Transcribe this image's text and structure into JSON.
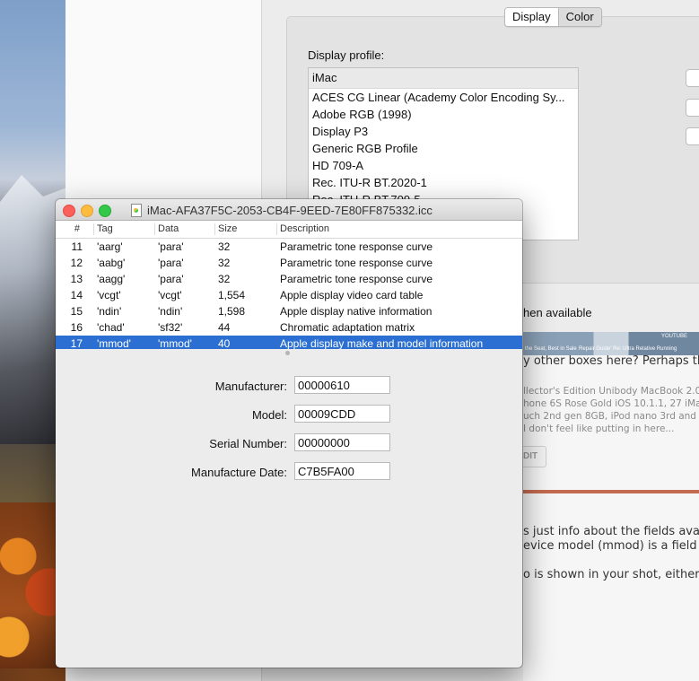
{
  "background_window": {
    "segmented": {
      "display_label": "Display",
      "color_label": "Color"
    },
    "display_profile_label": "Display profile:",
    "profile_list_header": "iMac",
    "profiles": [
      "ACES CG Linear (Academy Color Encoding Sy...",
      "Adobe RGB (1998)",
      "Display P3",
      "Generic RGB Profile",
      "HD 709-A",
      "Rec. ITU-R BT.2020-1",
      "Rec. ITU-R BT.709-5"
    ],
    "when_available_text": "hen available"
  },
  "webpage_fragment": {
    "thumb_caption_left": "the Seat, Best in Sale",
    "thumb_caption_mid": "Repair Guide' Re: Ultra Relative Running",
    "thumb_caption_right": "YOUTUBE",
    "line1": "y other boxes here? Perhaps the",
    "small_lines": [
      "llector's Edition Unibody MacBook 2.0 C",
      "hone 6S Rose Gold iOS 10.1.1, 27 iMac",
      "uch 2nd gen 8GB, iPod nano 3rd and 4",
      "I don't feel like putting in here..."
    ],
    "edit_label": "DIT",
    "para1": "s just info about the fields availa",
    "para2": "evice model (mmod) is a field of i",
    "para3": "o is shown in your shot, either."
  },
  "icc_window": {
    "title": "iMac-AFA37F5C-2053-CB4F-9EED-7E80FF875332.icc",
    "columns": [
      "#",
      "Tag",
      "Data",
      "Size",
      "Description"
    ],
    "rows": [
      {
        "num": "11",
        "tag": "'aarg'",
        "data": "'para'",
        "size": "32",
        "desc": "Parametric tone response curve"
      },
      {
        "num": "12",
        "tag": "'aabg'",
        "data": "'para'",
        "size": "32",
        "desc": "Parametric tone response curve"
      },
      {
        "num": "13",
        "tag": "'aagg'",
        "data": "'para'",
        "size": "32",
        "desc": "Parametric tone response curve"
      },
      {
        "num": "14",
        "tag": "'vcgt'",
        "data": "'vcgt'",
        "size": "1,554",
        "desc": "Apple display video card table"
      },
      {
        "num": "15",
        "tag": "'ndin'",
        "data": "'ndin'",
        "size": "1,598",
        "desc": "Apple display native information"
      },
      {
        "num": "16",
        "tag": "'chad'",
        "data": "'sf32'",
        "size": "44",
        "desc": "Chromatic adaptation matrix"
      },
      {
        "num": "17",
        "tag": "'mmod'",
        "data": "'mmod'",
        "size": "40",
        "desc": "Apple display make and model information"
      }
    ],
    "selected_row": "17",
    "fields": {
      "manufacturer_label": "Manufacturer:",
      "manufacturer_value": "00000610",
      "model_label": "Model:",
      "model_value": "00009CDD",
      "serial_label": "Serial Number:",
      "serial_value": "00000000",
      "date_label": "Manufacture Date:",
      "date_value": "C7B5FA00"
    }
  },
  "colors": {
    "selection_blue": "#2a6fd1",
    "close_red": "#fc605b",
    "minimize_yellow": "#fdbc40",
    "zoom_green": "#34c84a"
  }
}
